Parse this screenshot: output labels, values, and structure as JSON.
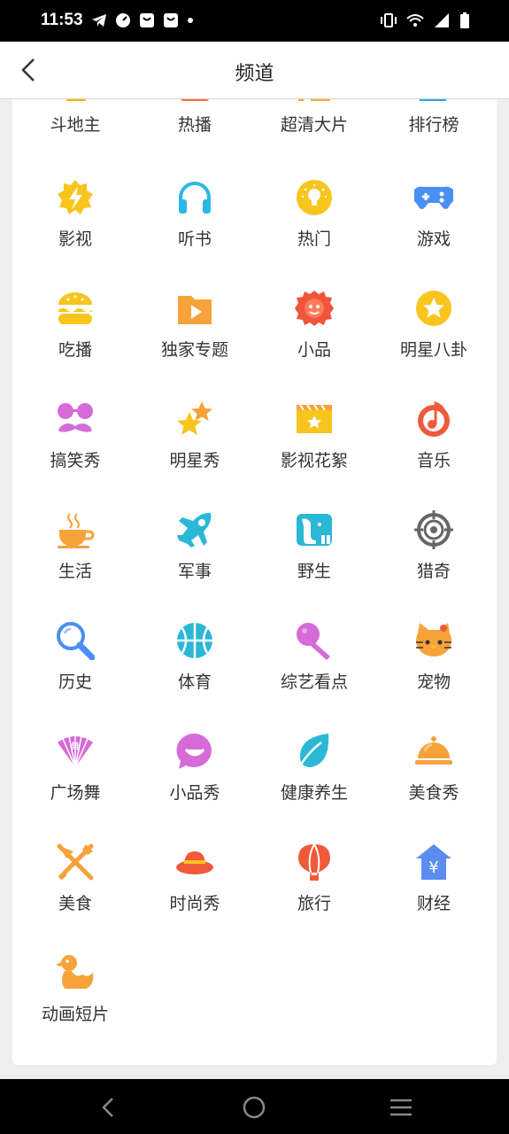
{
  "status_bar": {
    "time": "11:53"
  },
  "header": {
    "title": "频道"
  },
  "channels_partial": [
    {
      "label": "斗地主",
      "icon": "cards-icon"
    },
    {
      "label": "热播",
      "icon": "hot-play-icon"
    },
    {
      "label": "超清大片",
      "icon": "hd-movie-icon"
    },
    {
      "label": "排行榜",
      "icon": "ranking-icon"
    }
  ],
  "channels": [
    {
      "label": "影视",
      "icon": "film-bolt-icon"
    },
    {
      "label": "听书",
      "icon": "headphones-icon"
    },
    {
      "label": "热门",
      "icon": "lightbulb-icon"
    },
    {
      "label": "游戏",
      "icon": "gamepad-icon"
    },
    {
      "label": "吃播",
      "icon": "burger-icon"
    },
    {
      "label": "独家专题",
      "icon": "video-folder-icon"
    },
    {
      "label": "小品",
      "icon": "lion-mascot-icon"
    },
    {
      "label": "明星八卦",
      "icon": "star-badge-icon"
    },
    {
      "label": "搞笑秀",
      "icon": "mustache-glasses-icon"
    },
    {
      "label": "明星秀",
      "icon": "double-star-icon"
    },
    {
      "label": "影视花絮",
      "icon": "clapperboard-icon"
    },
    {
      "label": "音乐",
      "icon": "music-note-icon"
    },
    {
      "label": "生活",
      "icon": "coffee-cup-icon"
    },
    {
      "label": "军事",
      "icon": "jet-icon"
    },
    {
      "label": "野生",
      "icon": "elephant-icon"
    },
    {
      "label": "猎奇",
      "icon": "crosshair-icon"
    },
    {
      "label": "历史",
      "icon": "magnifier-icon"
    },
    {
      "label": "体育",
      "icon": "basketball-icon"
    },
    {
      "label": "综艺看点",
      "icon": "microphone-icon"
    },
    {
      "label": "宠物",
      "icon": "cat-face-icon"
    },
    {
      "label": "广场舞",
      "icon": "fan-icon"
    },
    {
      "label": "小品秀",
      "icon": "chat-smile-icon"
    },
    {
      "label": "健康养生",
      "icon": "leaf-icon"
    },
    {
      "label": "美食秀",
      "icon": "food-cloche-icon"
    },
    {
      "label": "美食",
      "icon": "fork-knife-icon"
    },
    {
      "label": "时尚秀",
      "icon": "sun-hat-icon"
    },
    {
      "label": "旅行",
      "icon": "hot-air-balloon-icon"
    },
    {
      "label": "财经",
      "icon": "yuan-house-icon"
    },
    {
      "label": "动画短片",
      "icon": "duck-icon"
    }
  ]
}
